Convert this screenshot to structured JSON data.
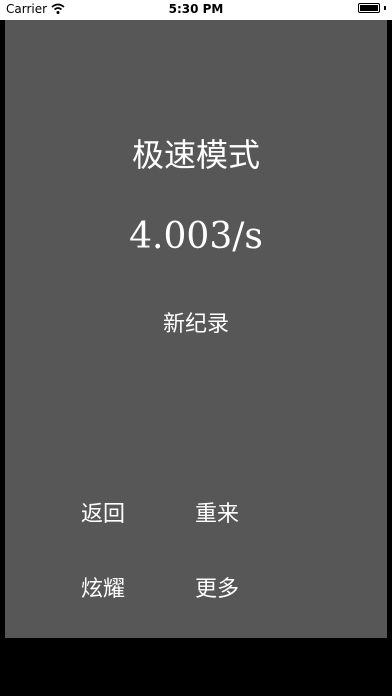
{
  "status_bar": {
    "carrier": "Carrier",
    "time": "5:30 PM",
    "wifi_icon": "wifi-icon",
    "battery_icon": "battery-icon",
    "battery_level": 1.0
  },
  "result": {
    "mode_title": "极速模式",
    "time_value": "4.003/s",
    "record_label": "新纪录"
  },
  "buttons": {
    "back": "返回",
    "restart": "重来",
    "share": "炫耀",
    "more": "更多"
  },
  "colors": {
    "screen_background": "#575757",
    "text": "#ffffff",
    "status_bar_background": "#ffffff"
  }
}
